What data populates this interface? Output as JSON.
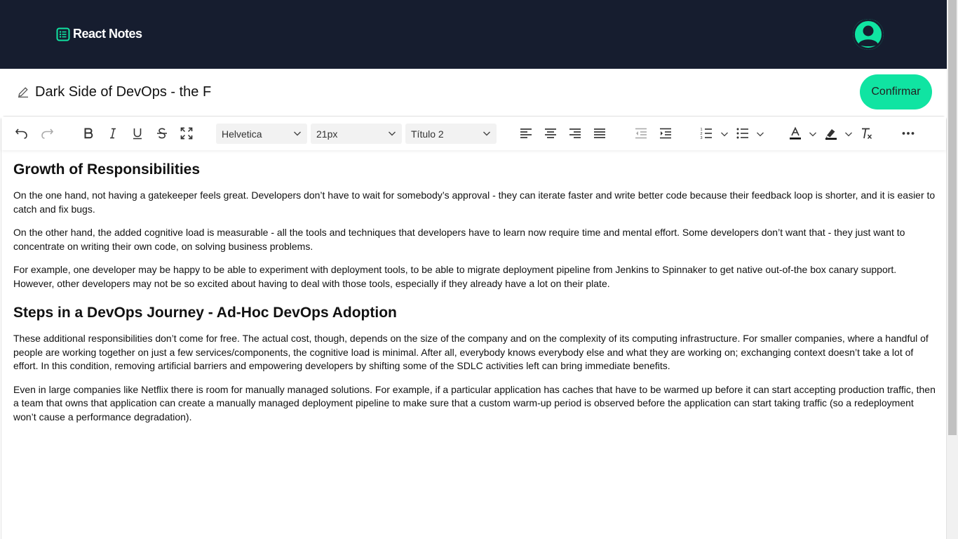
{
  "header": {
    "app_name": "React Notes",
    "brand_icon": "notes-list-icon",
    "avatar_icon": "user-avatar-icon"
  },
  "note": {
    "title_value": "Dark Side of DevOps - the F",
    "confirm_label": "Confirmar"
  },
  "toolbar": {
    "font_family": "Helvetica",
    "font_size": "21px",
    "block_style": "Título 2",
    "icons": [
      "undo-icon",
      "redo-icon",
      "bold-icon",
      "italic-icon",
      "underline-icon",
      "strikethrough-icon",
      "fullscreen-icon",
      "align-left-icon",
      "align-center-icon",
      "align-right-icon",
      "align-justify-icon",
      "outdent-icon",
      "indent-icon",
      "numbered-list-icon",
      "bullet-list-icon",
      "text-color-icon",
      "highlight-icon",
      "clear-formatting-icon",
      "more-icon"
    ]
  },
  "content": {
    "heading1": "Growth of Responsibilities",
    "p1": "On the one hand, not having a gatekeeper feels great. Developers don’t have to wait for somebody’s approval - they can iterate faster and write better code because their feedback loop is shorter, and it is easier to catch and fix bugs.",
    "p2": "On the other hand, the added cognitive load is measurable - all the tools and techniques that developers have to learn now require time and mental effort. Some developers don’t want that - they just want to concentrate on writing their own code, on solving business problems.",
    "p3": "For example, one developer may be happy to be able to experiment with deployment tools, to be able to migrate deployment pipeline from Jenkins to Spinnaker to get native out-of-the box canary support. However, other developers may not be so excited about having to deal with those tools, especially if they already have a lot on their plate.",
    "heading2": "Steps in a DevOps Journey - Ad-Hoc DevOps Adoption",
    "p4": "These additional responsibilities don’t come for free. The actual cost, though, depends on the size of the company and on the complexity of its computing infrastructure. For smaller companies, where a handful of people are working together on just a few services/components, the cognitive load is minimal. After all, everybody knows everybody else and what they are working on; exchanging context doesn’t take a lot of effort. In this condition, removing artificial barriers and empowering developers by shifting some of the SDLC activities left can bring immediate benefits.",
    "p5": "Even in large companies like Netflix there is room for manually managed solutions. For example, if a particular application has caches that have to be warmed up before it can start accepting production traffic, then a team that owns that application can create a manually managed deployment pipeline to make sure that a custom warm-up period is observed before the application can start taking traffic (so a redeployment won’t cause a performance degradation)."
  },
  "colors": {
    "header_bg": "#161d2f",
    "accent": "#10e4a2"
  }
}
